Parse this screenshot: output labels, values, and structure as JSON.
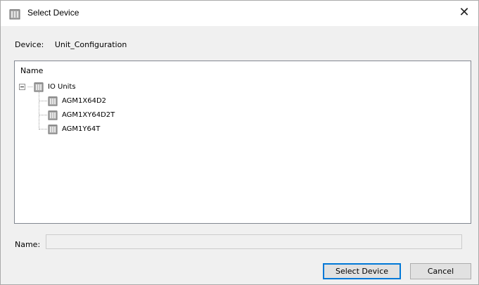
{
  "window": {
    "title": "Select Device",
    "close_glyph": "✕"
  },
  "device": {
    "label": "Device:",
    "value": "Unit_Configuration"
  },
  "tree": {
    "column_header": "Name",
    "root": {
      "label": "IO Units",
      "icon": "module-icon",
      "expanded": true
    },
    "children": [
      {
        "label": "AGM1X64D2",
        "icon": "module-icon"
      },
      {
        "label": "AGM1XY64D2T",
        "icon": "module-icon"
      },
      {
        "label": "AGM1Y64T",
        "icon": "module-icon"
      }
    ]
  },
  "name_field": {
    "label": "Name:",
    "value": ""
  },
  "buttons": {
    "select": "Select Device",
    "cancel": "Cancel"
  },
  "colors": {
    "accent": "#0078d7",
    "dialog_bg": "#f0f0f0",
    "module_icon": "#7f7f7f"
  }
}
